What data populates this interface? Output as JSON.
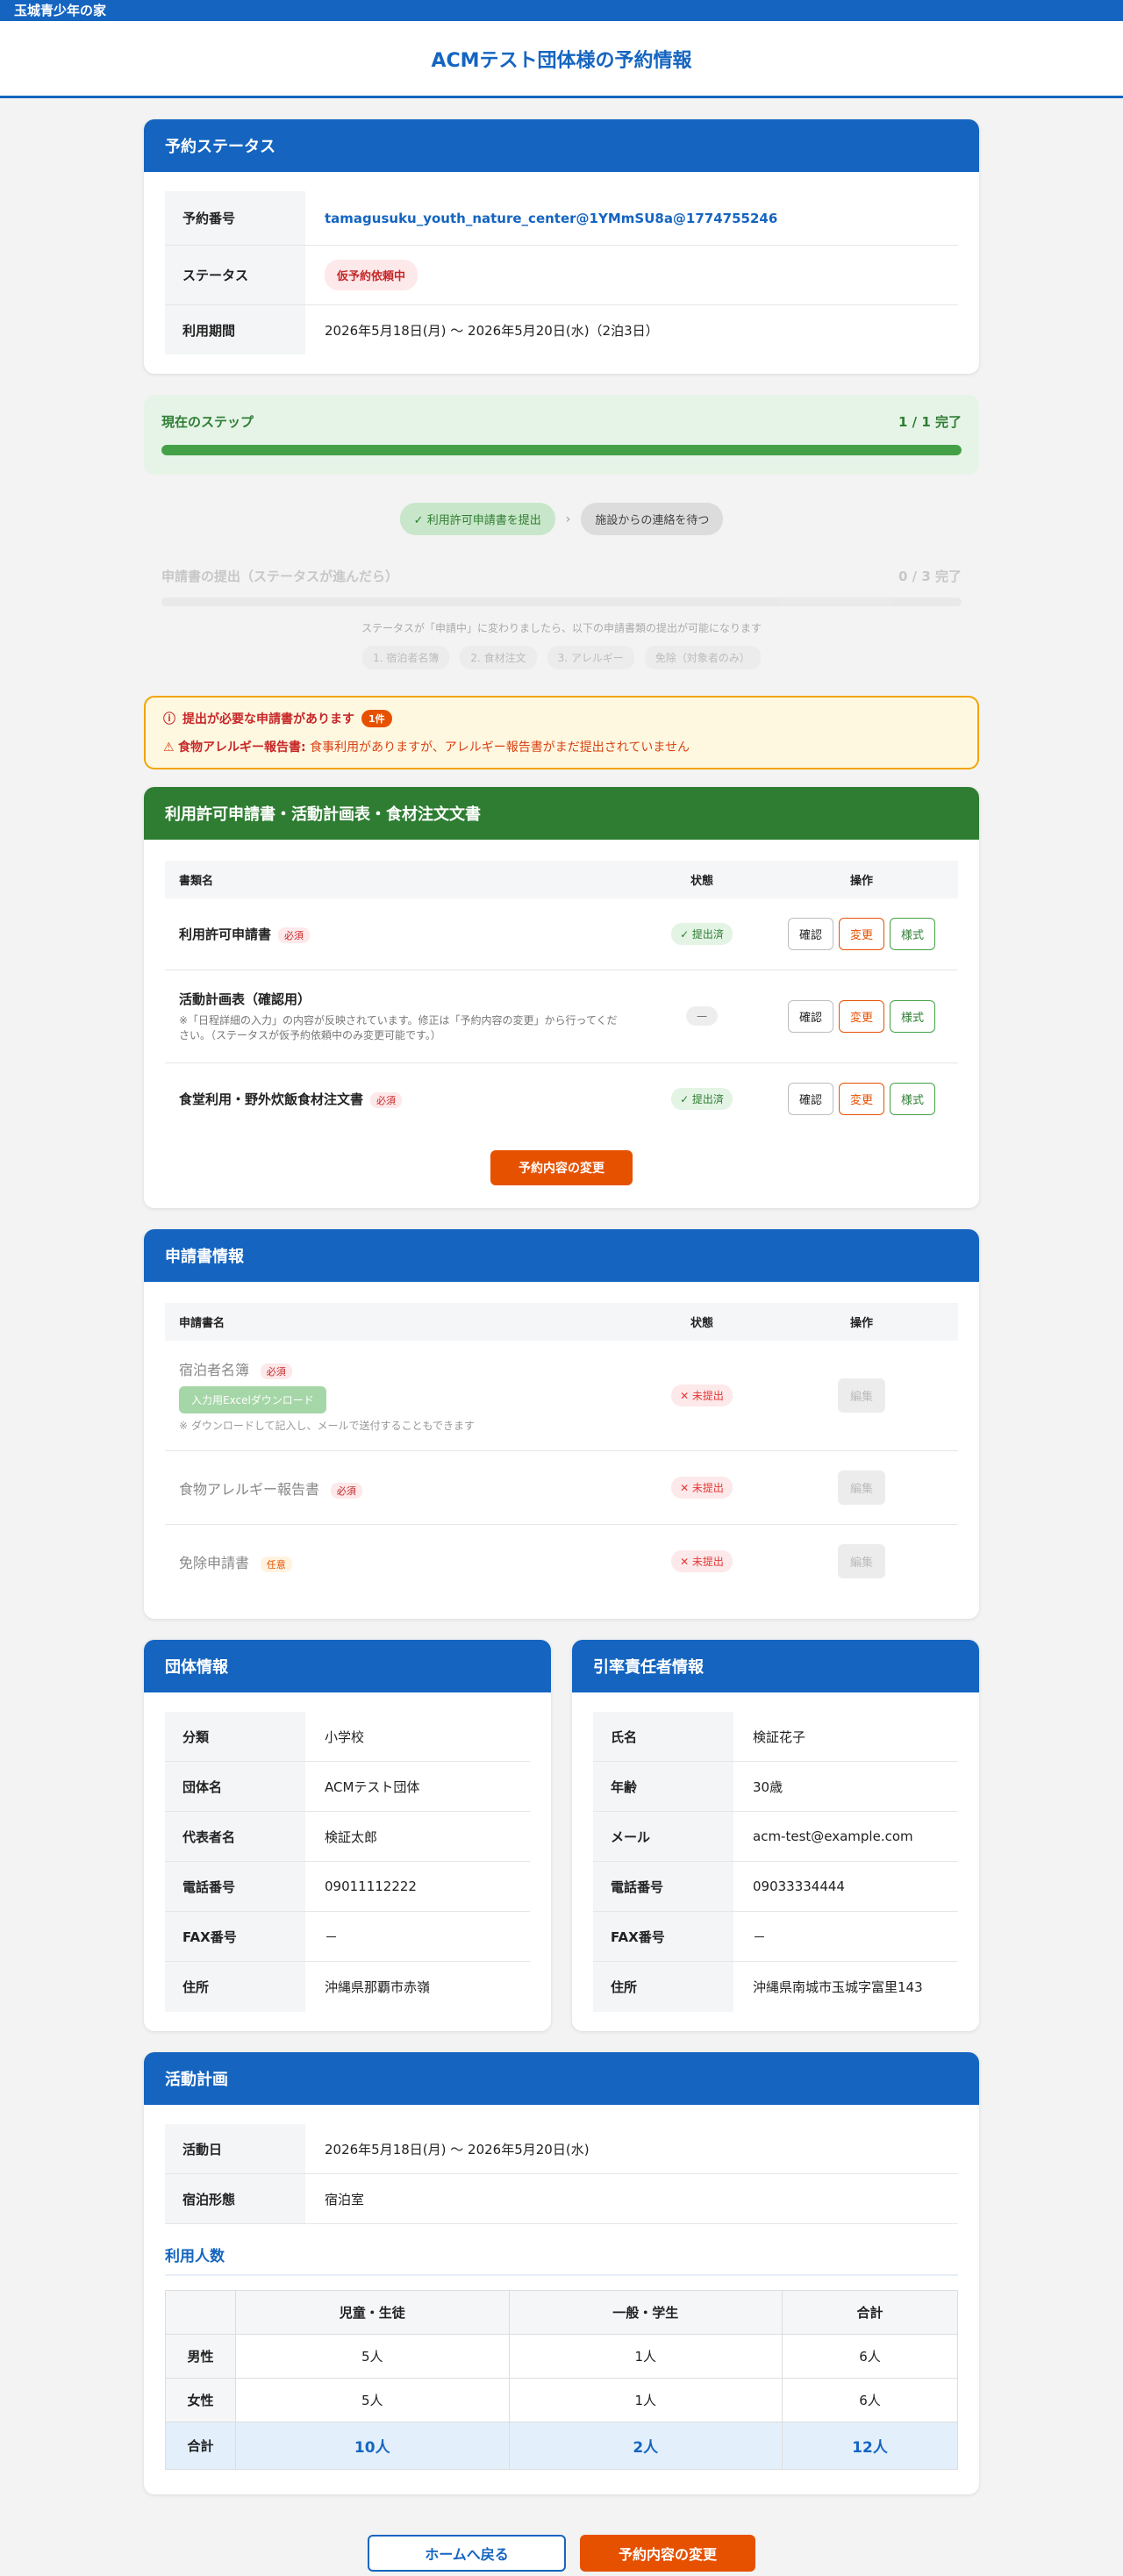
{
  "site": {
    "name": "玉城青少年の家"
  },
  "page": {
    "title": "ACMテスト団体様の予約情報"
  },
  "status_card": {
    "title": "予約ステータス",
    "rows": {
      "reservation_no": {
        "label": "予約番号",
        "value": "tamagusuku_youth_nature_center@1YMmSU8a@1774755246"
      },
      "status": {
        "label": "ステータス",
        "icon": "",
        "value": "仮予約依頼中"
      },
      "period": {
        "label": "利用期間",
        "value": "2026年5月18日(月) 〜 2026年5月20日(水)（2泊3日）"
      }
    }
  },
  "current_step": {
    "label": "現在のステップ",
    "count": "1 / 1 完了",
    "progress": 1.0
  },
  "steps": [
    {
      "label": "✓ 利用許可申請書を提出"
    },
    {
      "label": "施設からの連絡を待つ"
    }
  ],
  "step_arrow": "›",
  "forms_step": {
    "label": "申請書の提出（ステータスが進んだら）",
    "count": "0 / 3 完了",
    "note": "ステータスが「申請中」に変わりましたら、以下の申請書類の提出が可能になります",
    "items": [
      "1. 宿泊者名簿",
      "2. 食材注文",
      "3. アレルギー",
      "免除（対象者のみ）"
    ]
  },
  "alert": {
    "icon": "ⓘ",
    "title": "提出が必要な申請書があります",
    "count": "1件",
    "warn_icon": "⚠",
    "item_name": "食物アレルギー報告書:",
    "item_msg": " 食事利用がありますが、アレルギー報告書がまだ提出されていません"
  },
  "permit_card": {
    "title": "利用許可申請書・活動計画表・食材注文文書",
    "headers": {
      "name": "書類名",
      "status": "状態",
      "ops": "操作"
    },
    "rows": [
      {
        "name": "利用許可申請書",
        "badge": "必須",
        "sub": "",
        "status": "✓ 提出済"
      },
      {
        "name": "活動計画表（確認用）",
        "badge": "",
        "sub": "※「日程詳細の入力」の内容が反映されています。修正は「予約内容の変更」から行ってください。（ステータスが仮予約依頼中のみ変更可能です。）",
        "status": "—"
      },
      {
        "name": "食堂利用・野外炊飯食材注文書",
        "badge": "必須",
        "sub": "",
        "status": "✓ 提出済"
      }
    ],
    "buttons": {
      "confirm": "確認",
      "change": "変更",
      "format": "様式"
    },
    "change_button": "予約内容の変更"
  },
  "app_card": {
    "title": "申請書情報",
    "title_icon": "",
    "headers": {
      "name": "申請書名",
      "status": "状態",
      "ops": "操作"
    },
    "rows": [
      {
        "name": "宿泊者名簿",
        "icon": "",
        "badge": "必須",
        "status": "✕ 未提出",
        "button": "編集 "
      },
      {
        "name": "食物アレルギー報告書",
        "icon": "",
        "badge": "必須",
        "status": "✕ 未提出",
        "button": "編集 "
      },
      {
        "name": "免除申請書",
        "icon": "",
        "badge": "任意",
        "status": "✕ 未提出",
        "button": "編集 "
      }
    ],
    "download_button": "入力用Excelダウンロード",
    "download_note": "※ ダウンロードして記入し、メールで送付することもできます"
  },
  "group_card": {
    "title": "団体情報",
    "rows": [
      {
        "label": "分類",
        "value": "小学校"
      },
      {
        "label": "団体名",
        "value": "ACMテスト団体"
      },
      {
        "label": "代表者名",
        "value": "検証太郎"
      },
      {
        "label": "電話番号",
        "value": "09011112222"
      },
      {
        "label": "FAX番号",
        "value": "－"
      },
      {
        "label": "住所",
        "value": "沖縄県那覇市赤嶺"
      }
    ]
  },
  "leader_card": {
    "title": "引率責任者情報",
    "rows": [
      {
        "label": "氏名",
        "value": "検証花子"
      },
      {
        "label": "年齢",
        "value": "30歳"
      },
      {
        "label": "メール",
        "value": "acm-test@example.com"
      },
      {
        "label": "電話番号",
        "value": "09033334444"
      },
      {
        "label": "FAX番号",
        "value": "－"
      },
      {
        "label": "住所",
        "value": "沖縄県南城市玉城字富里143"
      }
    ]
  },
  "plan_card": {
    "title": "活動計画",
    "rows": [
      {
        "label": "活動日",
        "value": "2026年5月18日(月) 〜 2026年5月20日(水)"
      },
      {
        "label": "宿泊形態",
        "value": "宿泊室"
      }
    ],
    "people_title": "利用人数",
    "people": {
      "headers": [
        "",
        "児童・生徒",
        "一般・学生",
        "合計"
      ],
      "rows": [
        [
          "男性",
          "5人",
          "1人",
          "6人"
        ],
        [
          "女性",
          "5人",
          "1人",
          "6人"
        ]
      ],
      "total": [
        "合計",
        "10人",
        "2人",
        "12人"
      ]
    }
  },
  "footer": {
    "home_button": "ホームへ戻る",
    "change_button": "予約内容の変更"
  }
}
